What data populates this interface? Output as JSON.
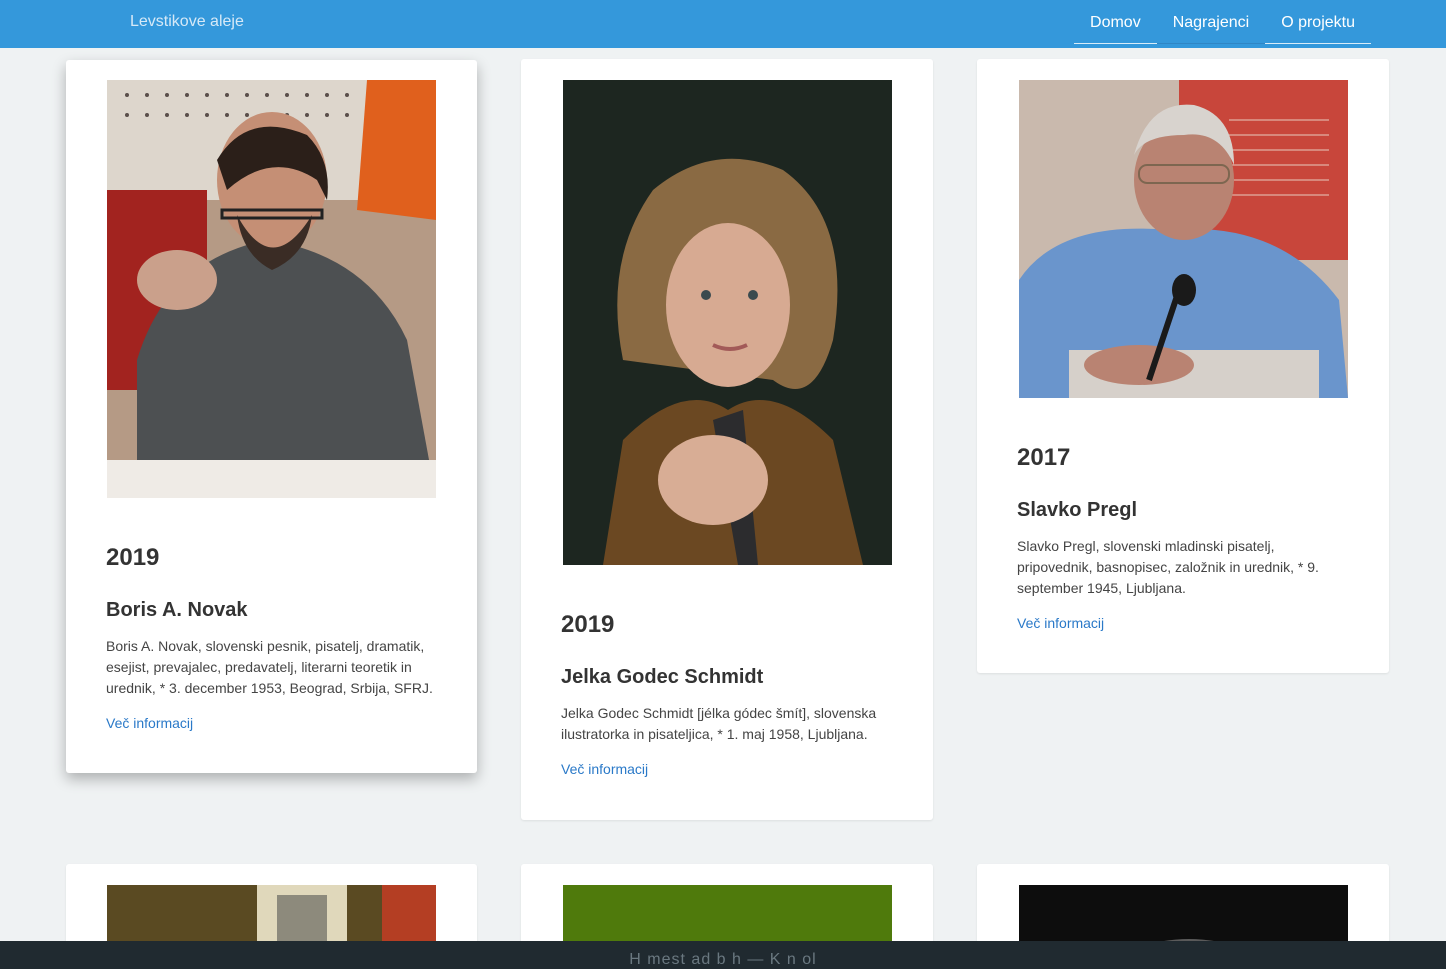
{
  "navbar": {
    "brand": "Levstikove aleje",
    "links": [
      {
        "label": "Domov"
      },
      {
        "label": "Nagrajenci"
      },
      {
        "label": "O projektu"
      }
    ]
  },
  "colors": {
    "navbar": "#3498db",
    "background": "#eff2f3",
    "link": "#2a79c8",
    "footer": "#202a30"
  },
  "awardees": [
    {
      "year": "2019",
      "name": "Boris A. Novak",
      "description": "Boris A. Novak, slovenski pesnik, pisatelj, dramatik, esejist, prevajalec, predavatelj, literarni teoretik in urednik, * 3. december 1953, Beograd, Srbija, SFRJ.",
      "link": "Več informacij"
    },
    {
      "year": "2019",
      "name": "Jelka Godec Schmidt",
      "description": "Jelka Godec Schmidt [jélka gódec šmít], slovenska ilustratorka in pisateljica, * 1. maj 1958, Ljubljana.",
      "link": "Več informacij"
    },
    {
      "year": "2017",
      "name": "Slavko Pregl",
      "description": "Slavko Pregl, slovenski mladinski pisatelj, pripovednik, basnopisec, založnik in urednik, * 9. september 1945, Ljubljana.",
      "link": "Več informacij"
    }
  ],
  "footer": {
    "text": "H  mest ad  b   h — K  n  ol"
  }
}
